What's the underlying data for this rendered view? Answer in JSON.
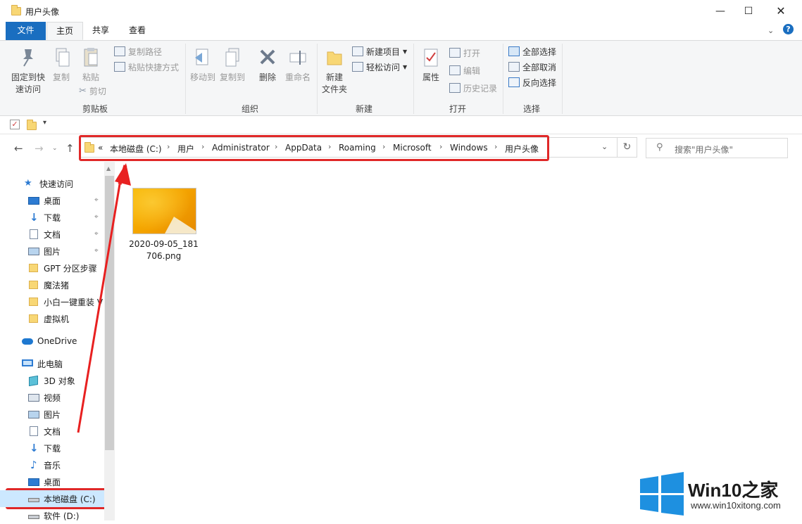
{
  "window": {
    "title": "用户头像"
  },
  "tabs": [
    "文件",
    "主页",
    "共享",
    "查看"
  ],
  "ribbon": {
    "clipboard": {
      "pin": "固定到快\n速访问",
      "pin1": "固定到快",
      "pin2": "速访问",
      "copy": "复制",
      "paste": "粘贴",
      "copy_path": "复制路径",
      "paste_shortcut": "粘贴快捷方式",
      "cut": "剪切",
      "label": "剪贴板"
    },
    "organize": {
      "move_to": "移动到",
      "copy_to": "复制到",
      "delete": "删除",
      "rename": "重命名",
      "label": "组织"
    },
    "new": {
      "new_folder1": "新建",
      "new_folder2": "文件夹",
      "new_item": "新建项目",
      "easy_access": "轻松访问",
      "label": "新建"
    },
    "open": {
      "properties": "属性",
      "open": "打开",
      "edit": "编辑",
      "history": "历史记录",
      "label": "打开"
    },
    "select": {
      "select_all": "全部选择",
      "select_none": "全部取消",
      "invert": "反向选择",
      "label": "选择"
    }
  },
  "address": {
    "prefix": "«",
    "crumbs": [
      "本地磁盘 (C:)",
      "用户",
      "Administrator",
      "AppData",
      "Roaming",
      "Microsoft",
      "Windows",
      "用户头像"
    ]
  },
  "search": {
    "placeholder": "搜索\"用户头像\""
  },
  "nav": {
    "quick_access": "快速访问",
    "qa_items": [
      "桌面",
      "下载",
      "文档",
      "图片",
      "GPT 分区步骤",
      "魔法猪",
      "小白一键重装 V",
      "虚拟机"
    ],
    "onedrive": "OneDrive",
    "this_pc": "此电脑",
    "pc_items": [
      "3D 对象",
      "视频",
      "图片",
      "文档",
      "下载",
      "音乐",
      "桌面",
      "本地磁盘 (C:)",
      "软件 (D:)"
    ]
  },
  "files": [
    {
      "name": "2020-09-05_181706.png",
      "name_line1": "2020-09-05_181",
      "name_line2": "706.png"
    }
  ],
  "watermark": {
    "brand": "Win10",
    "brand_zh": "之家",
    "url": "www.win10xitong.com"
  },
  "colors": {
    "accent": "#1a6ec0",
    "highlight": "#e02828",
    "win_blue": "#1e90e0"
  }
}
